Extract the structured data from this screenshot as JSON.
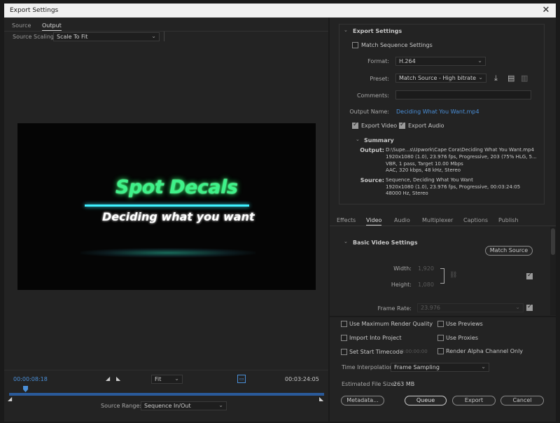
{
  "window": {
    "title": "Export Settings"
  },
  "left_tabs": {
    "source": "Source",
    "output": "Output"
  },
  "source_scaling": {
    "label": "Source Scaling:",
    "value": "Scale To Fit"
  },
  "preview": {
    "title": "Spot Decals",
    "subtitle": "Deciding what you want"
  },
  "timeline": {
    "current": "00:00:08:18",
    "zoom": "Fit",
    "end": "00:03:24:05",
    "source_range_label": "Source Range:",
    "source_range_value": "Sequence In/Out"
  },
  "export_settings": {
    "header": "Export Settings",
    "match_sequence": "Match Sequence Settings",
    "format_label": "Format:",
    "format_value": "H.264",
    "preset_label": "Preset:",
    "preset_value": "Match Source - High bitrate",
    "comments_label": "Comments:",
    "output_name_label": "Output Name:",
    "output_name_value": "Deciding What You Want.mp4",
    "export_video": "Export Video",
    "export_audio": "Export Audio"
  },
  "summary": {
    "header": "Summary",
    "output_label": "Output:",
    "output_lines": [
      "D:\\Supe...s\\Upwork\\Cape Cora\\Deciding What You Want.mp4",
      "1920x1080 (1.0), 23.976 fps, Progressive, 203 (75% HLG, 5...",
      "VBR, 1 pass, Target 10.00 Mbps",
      "AAC, 320 kbps, 48 kHz, Stereo"
    ],
    "source_label": "Source:",
    "source_lines": [
      "Sequence, Deciding What You Want",
      "1920x1080 (1.0), 23.976 fps, Progressive, 00:03:24:05",
      "48000 Hz, Stereo"
    ]
  },
  "right_tabs": [
    "Effects",
    "Video",
    "Audio",
    "Multiplexer",
    "Captions",
    "Publish"
  ],
  "basic_video": {
    "header": "Basic Video Settings",
    "match_source": "Match Source",
    "width_label": "Width:",
    "width_value": "1,920",
    "height_label": "Height:",
    "height_value": "1,080",
    "frame_rate_label": "Frame Rate:",
    "frame_rate_value": "23.976"
  },
  "options": {
    "max_render": "Use Maximum Render Quality",
    "use_previews": "Use Previews",
    "import_project": "Import Into Project",
    "use_proxies": "Use Proxies",
    "start_timecode": "Set Start Timecode",
    "start_timecode_value": "00:00:00:00",
    "render_alpha": "Render Alpha Channel Only",
    "time_interp_label": "Time Interpolation:",
    "time_interp_value": "Frame Sampling",
    "file_size_label": "Estimated File Size:",
    "file_size_value": "263 MB"
  },
  "buttons": {
    "metadata": "Metadata...",
    "queue": "Queue",
    "export": "Export",
    "cancel": "Cancel"
  }
}
